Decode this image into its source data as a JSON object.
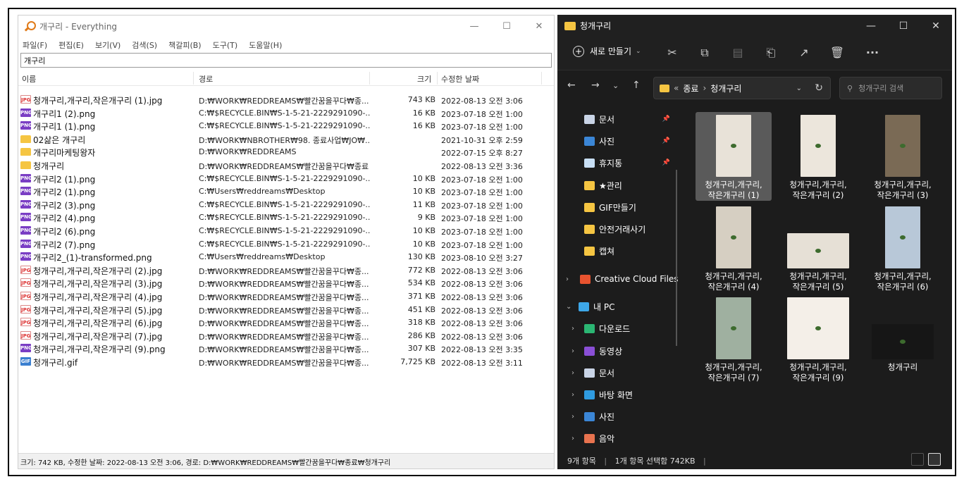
{
  "everything": {
    "title": "개구리 - Everything",
    "menu": [
      "파일(F)",
      "편집(E)",
      "보기(V)",
      "검색(S)",
      "책갈피(B)",
      "도구(T)",
      "도움말(H)"
    ],
    "search_value": "개구리",
    "columns": {
      "name": "이름",
      "path": "경로",
      "size": "크기",
      "date": "수정한 날짜"
    },
    "rows": [
      {
        "icon": "jpg",
        "name": "청개구리,개구리,작은개구리 (1).jpg",
        "path": "D:₩WORK₩REDDREAMS₩빨간꿈을꾸다₩종...",
        "size": "743 KB",
        "date": "2022-08-13 오전 3:06"
      },
      {
        "icon": "png",
        "name": "개구리1 (2).png",
        "path": "C:₩$RECYCLE.BIN₩S-1-5-21-2229291090-...",
        "size": "16 KB",
        "date": "2023-07-18 오전 1:00"
      },
      {
        "icon": "png",
        "name": "개구리1 (1).png",
        "path": "C:₩$RECYCLE.BIN₩S-1-5-21-2229291090-...",
        "size": "16 KB",
        "date": "2023-07-18 오전 1:00"
      },
      {
        "icon": "folder",
        "name": "02삶은 개구리",
        "path": "D:₩WORK₩NBROTHER₩98. 종료사업₩JO₩...",
        "size": "",
        "date": "2021-10-31 오후 2:59"
      },
      {
        "icon": "folder",
        "name": "개구리마케팅왕자",
        "path": "D:₩WORK₩REDDREAMS",
        "size": "",
        "date": "2022-07-15 오후 8:27"
      },
      {
        "icon": "folder",
        "name": "청개구리",
        "path": "D:₩WORK₩REDDREAMS₩빨간꿈을꾸다₩종료",
        "size": "",
        "date": "2022-08-13 오전 3:36"
      },
      {
        "icon": "png",
        "name": "개구리2 (1).png",
        "path": "C:₩$RECYCLE.BIN₩S-1-5-21-2229291090-...",
        "size": "10 KB",
        "date": "2023-07-18 오전 1:00"
      },
      {
        "icon": "png",
        "name": "개구리2 (1).png",
        "path": "C:₩Users₩reddreams₩Desktop",
        "size": "10 KB",
        "date": "2023-07-18 오전 1:00"
      },
      {
        "icon": "png",
        "name": "개구리2 (3).png",
        "path": "C:₩$RECYCLE.BIN₩S-1-5-21-2229291090-...",
        "size": "11 KB",
        "date": "2023-07-18 오전 1:00"
      },
      {
        "icon": "png",
        "name": "개구리2 (4).png",
        "path": "C:₩$RECYCLE.BIN₩S-1-5-21-2229291090-...",
        "size": "9 KB",
        "date": "2023-07-18 오전 1:00"
      },
      {
        "icon": "png",
        "name": "개구리2 (6).png",
        "path": "C:₩$RECYCLE.BIN₩S-1-5-21-2229291090-...",
        "size": "10 KB",
        "date": "2023-07-18 오전 1:00"
      },
      {
        "icon": "png",
        "name": "개구리2 (7).png",
        "path": "C:₩$RECYCLE.BIN₩S-1-5-21-2229291090-...",
        "size": "10 KB",
        "date": "2023-07-18 오전 1:00"
      },
      {
        "icon": "png",
        "name": "개구리2_(1)-transformed.png",
        "path": "C:₩Users₩reddreams₩Desktop",
        "size": "130 KB",
        "date": "2023-08-10 오전 3:27"
      },
      {
        "icon": "jpg",
        "name": "청개구리,개구리,작은개구리 (2).jpg",
        "path": "D:₩WORK₩REDDREAMS₩빨간꿈을꾸다₩종...",
        "size": "772 KB",
        "date": "2022-08-13 오전 3:06"
      },
      {
        "icon": "jpg",
        "name": "청개구리,개구리,작은개구리 (3).jpg",
        "path": "D:₩WORK₩REDDREAMS₩빨간꿈을꾸다₩종...",
        "size": "534 KB",
        "date": "2022-08-13 오전 3:06"
      },
      {
        "icon": "jpg",
        "name": "청개구리,개구리,작은개구리 (4).jpg",
        "path": "D:₩WORK₩REDDREAMS₩빨간꿈을꾸다₩종...",
        "size": "371 KB",
        "date": "2022-08-13 오전 3:06"
      },
      {
        "icon": "jpg",
        "name": "청개구리,개구리,작은개구리 (5).jpg",
        "path": "D:₩WORK₩REDDREAMS₩빨간꿈을꾸다₩종...",
        "size": "451 KB",
        "date": "2022-08-13 오전 3:06"
      },
      {
        "icon": "jpg",
        "name": "청개구리,개구리,작은개구리 (6).jpg",
        "path": "D:₩WORK₩REDDREAMS₩빨간꿈을꾸다₩종...",
        "size": "318 KB",
        "date": "2022-08-13 오전 3:06"
      },
      {
        "icon": "jpg",
        "name": "청개구리,개구리,작은개구리 (7).jpg",
        "path": "D:₩WORK₩REDDREAMS₩빨간꿈을꾸다₩종...",
        "size": "286 KB",
        "date": "2022-08-13 오전 3:06"
      },
      {
        "icon": "png",
        "name": "청개구리,개구리,작은개구리 (9).png",
        "path": "D:₩WORK₩REDDREAMS₩빨간꿈을꾸다₩종...",
        "size": "307 KB",
        "date": "2022-08-13 오전 3:35"
      },
      {
        "icon": "gif",
        "name": "청개구리.gif",
        "path": "D:₩WORK₩REDDREAMS₩빨간꿈을꾸다₩종...",
        "size": "7,725 KB",
        "date": "2022-08-13 오전 3:11"
      }
    ],
    "icon_labels": {
      "jpg": "JPG",
      "png": "PNG",
      "gif": "GIF",
      "folder": ""
    },
    "status": "크기: 742 KB, 수정한 날짜: 2022-08-13 오전 3:06, 경로: D:₩WORK₩REDDREAMS₩빨간꿈을꾸다₩종료₩청개구리"
  },
  "explorer": {
    "title": "청개구리",
    "new_label": "새로 만들기",
    "breadcrumb": {
      "prefix": "«",
      "parent": "종료",
      "current": "청개구리"
    },
    "search_placeholder": "청개구리 검색",
    "sidebar": [
      {
        "label": "문서",
        "icon": "document-icon",
        "pinned": true
      },
      {
        "label": "사진",
        "icon": "pictures-icon",
        "pinned": true
      },
      {
        "label": "휴지통",
        "icon": "recycle-bin-icon",
        "pinned": true
      },
      {
        "label": "★관리",
        "icon": "folder-icon",
        "pinned": false
      },
      {
        "label": "GIF만들기",
        "icon": "folder-icon",
        "pinned": false
      },
      {
        "label": "안전거래사기",
        "icon": "folder-icon",
        "pinned": false
      },
      {
        "label": "캡쳐",
        "icon": "folder-icon",
        "pinned": false
      },
      {
        "label": "Creative Cloud Files",
        "icon": "creative-cloud-icon",
        "pinned": false
      },
      {
        "label": "내 PC",
        "icon": "pc-icon",
        "pinned": false
      },
      {
        "label": "다운로드",
        "icon": "download-icon",
        "pinned": false
      },
      {
        "label": "동영상",
        "icon": "video-icon",
        "pinned": false
      },
      {
        "label": "문서",
        "icon": "document-icon",
        "pinned": false
      },
      {
        "label": "바탕 화면",
        "icon": "desktop-icon",
        "pinned": false
      },
      {
        "label": "사진",
        "icon": "pictures-icon",
        "pinned": false
      },
      {
        "label": "음악",
        "icon": "music-icon",
        "pinned": false
      }
    ],
    "thumbnails": [
      {
        "label": "청개구리,개구리,작은개구리 (1)",
        "selected": true
      },
      {
        "label": "청개구리,개구리,작은개구리 (2)",
        "selected": false
      },
      {
        "label": "청개구리,개구리,작은개구리 (3)",
        "selected": false
      },
      {
        "label": "청개구리,개구리,작은개구리 (4)",
        "selected": false
      },
      {
        "label": "청개구리,개구리,작은개구리 (5)",
        "selected": false
      },
      {
        "label": "청개구리,개구리,작은개구리 (6)",
        "selected": false
      },
      {
        "label": "청개구리,개구리,작은개구리 (7)",
        "selected": false
      },
      {
        "label": "청개구리,개구리,작은개구리 (9)",
        "selected": false
      },
      {
        "label": "청개구리",
        "selected": false
      }
    ],
    "status_count": "9개 항목",
    "status_selected": "1개 항목 선택함 742KB"
  }
}
